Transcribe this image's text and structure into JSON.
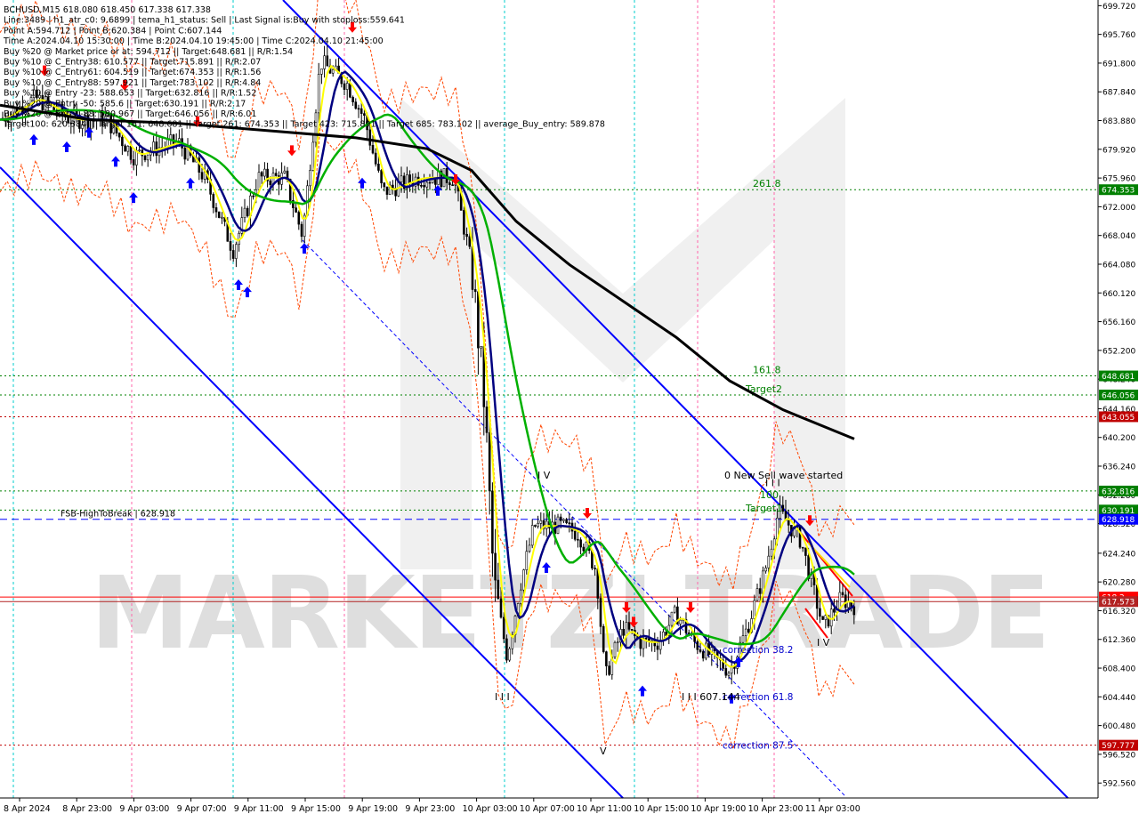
{
  "header": {
    "lines": [
      "BCHUSD,M15  618.080 618.450 617.338 617.338",
      "Line:3489 | h1_atr_c0: 9.6899 | tema_h1_status: Sell | Last Signal is:Buy with stoploss:559.641",
      "Point A:594.712 | Point B:620.384 | Point C:607.144",
      "Time A:2024.04.10 15:30:00 | Time B:2024.04.10 19:45:00 | Time C:2024.04.10 21:45:00",
      "Buy %20 @ Market price or at: 594.712 || Target:648.681 || R/R:1.54",
      "Buy %10 @ C_Entry38: 610.577 || Target:715.891 || R/R:2.07",
      "Buy %10 @ C_Entry61: 604.519 || Target:674.353 || R/R:1.56",
      "Buy %10 @ C_Entry88: 597.921 || Target:783.102 || R/R:4.84",
      "Buy %10 @ Entry -23: 588.653 || Target:632.816 || R/R:1.52",
      "Buy %20 @ Entry -50: 585.6 || Target:630.191 || R/R:2.17",
      "Buy %20 @ Entry -88: 580.967 || Target:646.056 || R/R:6.01",
      "Target100: 620.384 || Target 161: 648.681 || Target 261: 674.353 || Target 423: 715.891 || Target 685: 783.102 || average_Buy_entry: 589.878"
    ]
  },
  "watermark": "MARKETZI TRADE",
  "colors": {
    "blue_channel": "#0000ff",
    "black_ma": "#000000",
    "green_ma": "#00b000",
    "navy_ma": "#000080",
    "yellow_ma": "#ffff00",
    "orange_dashed": "#ff4500",
    "cyan_vline": "#00cccc",
    "pink_vline": "#ff66aa",
    "green_level": "#008000",
    "red_level": "#c00000",
    "price_tag": "#ff0000",
    "current_tag": "#b22222"
  },
  "chart_data": {
    "type": "candlestick",
    "symbol": "BCHUSD",
    "timeframe": "M15",
    "ylim": [
      590.5,
      700.5
    ],
    "y_ticks": [
      "699.720",
      "695.760",
      "691.800",
      "687.840",
      "683.880",
      "679.920",
      "675.960",
      "672.000",
      "668.040",
      "664.080",
      "660.120",
      "656.160",
      "652.200",
      "648.240",
      "644.160",
      "640.200",
      "636.240",
      "632.280",
      "628.320",
      "624.240",
      "620.280",
      "616.320",
      "612.360",
      "608.400",
      "604.440",
      "600.480",
      "596.520",
      "592.560"
    ],
    "x_ticks": [
      "8 Apr 2024",
      "8 Apr 23:00",
      "9 Apr 03:00",
      "9 Apr 07:00",
      "9 Apr 11:00",
      "9 Apr 15:00",
      "9 Apr 19:00",
      "9 Apr 23:00",
      "10 Apr 03:00",
      "10 Apr 07:00",
      "10 Apr 11:00",
      "10 Apr 15:00",
      "10 Apr 19:00",
      "10 Apr 23:00",
      "11 Apr 03:00"
    ],
    "levels": [
      {
        "label": "261.8",
        "value": 674.353,
        "tag": "674.353",
        "color": "#008000"
      },
      {
        "label": "161.8",
        "value": 648.681,
        "tag": "648.681",
        "color": "#008000"
      },
      {
        "label": "Target2",
        "value": 646.056,
        "tag": "646.056",
        "color": "#008000"
      },
      {
        "label": "",
        "value": 643.055,
        "tag": "643.055",
        "color": "#c00000"
      },
      {
        "label": "",
        "value": 632.816,
        "tag": "632.816",
        "color": "#008000"
      },
      {
        "label": "",
        "value": 630.191,
        "tag": "630.191",
        "color": "#008000"
      },
      {
        "label": "FSB-HighToBreak | 628.918",
        "value": 628.918,
        "tag": "628.918",
        "color": "#0000ff"
      },
      {
        "label": "",
        "value": 618.2,
        "tag": "618.2",
        "color": "#ff0000"
      },
      {
        "label": "",
        "value": 617.573,
        "tag": "617.573",
        "color": "#b22222"
      },
      {
        "label": "",
        "value": 597.777,
        "tag": "597.777",
        "color": "#c00000"
      }
    ],
    "annotations": [
      {
        "text": "0 New Sell wave started",
        "x": "10 Apr 23:00",
        "y": 634.5
      },
      {
        "text": "Target1",
        "x": "10 Apr 22:30",
        "y": 630.0
      },
      {
        "text": "100",
        "x": "10 Apr 22:30",
        "y": 631.8
      },
      {
        "text": "correction 38.2",
        "x": "10 Apr 20:00",
        "y": 610.5
      },
      {
        "text": "correction 61.8",
        "x": "10 Apr 20:00",
        "y": 604.0
      },
      {
        "text": "correction 87.5",
        "x": "10 Apr 20:00",
        "y": 597.3
      },
      {
        "text": "I I I",
        "x": "10 Apr 03:00",
        "y": 604.0
      },
      {
        "text": "I V",
        "x": "10 Apr 07:00",
        "y": 634.5
      },
      {
        "text": "I I I",
        "x": "10 Apr 23:00",
        "y": 633.5
      },
      {
        "text": "I V",
        "x": "11 Apr 03:00",
        "y": 611.5
      },
      {
        "text": "V",
        "x": "10 Apr 11:00",
        "y": 596.5
      },
      {
        "text": "I I I 607.144",
        "x": "10 Apr 17:30",
        "y": 604.0
      }
    ]
  }
}
